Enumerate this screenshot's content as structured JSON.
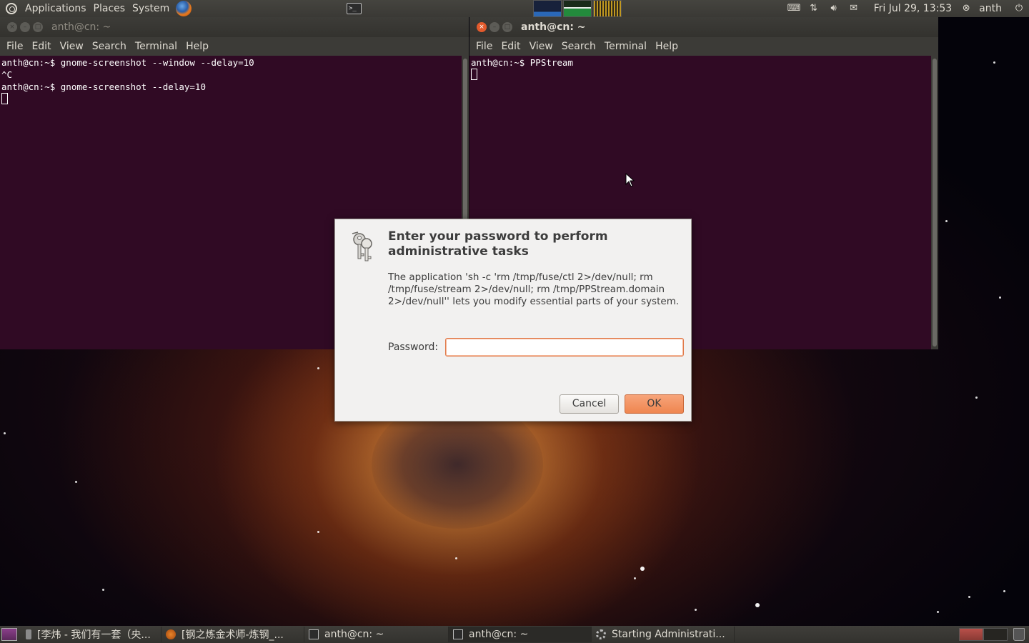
{
  "top_panel": {
    "menus": [
      "Applications",
      "Places",
      "System"
    ],
    "clock": "Fri Jul 29, 13:53",
    "user": "anth",
    "terminal_launcher_glyph": ">_",
    "tray_icons": [
      "keyboard-icon",
      "network-icon",
      "volume-icon",
      "mail-icon"
    ]
  },
  "left_terminal": {
    "title": "anth@cn: ~",
    "menu": [
      "File",
      "Edit",
      "View",
      "Search",
      "Terminal",
      "Help"
    ],
    "lines": [
      "anth@cn:~$ gnome-screenshot --window --delay=10",
      "^C",
      "anth@cn:~$ gnome-screenshot --delay=10"
    ]
  },
  "right_terminal": {
    "title": "anth@cn: ~",
    "menu": [
      "File",
      "Edit",
      "View",
      "Search",
      "Terminal",
      "Help"
    ],
    "lines": [
      "anth@cn:~$ PPStream"
    ]
  },
  "dialog": {
    "heading": "Enter your password to perform administrative tasks",
    "message": "The application 'sh -c 'rm /tmp/fuse/ctl  2>/dev/null; rm /tmp/fuse/stream  2>/dev/null; rm /tmp/PPStream.domain 2>/dev/null'' lets you modify essential parts of your system.",
    "password_label": "Password:",
    "password_value": "",
    "cancel_label": "Cancel",
    "ok_label": "OK"
  },
  "taskbar": {
    "tasks": [
      {
        "label": "[李炜 - 我们有一套（央..."
      },
      {
        "label": "[钢之炼金术师-炼钢_..."
      },
      {
        "label": "anth@cn: ~"
      },
      {
        "label": "anth@cn: ~"
      },
      {
        "label": "Starting Administrati..."
      }
    ]
  },
  "colors": {
    "terminal_bg": "#300a24",
    "panel_bg": "#3c3b37",
    "accent_orange": "#ef8650",
    "close_button": "#e35a2c"
  }
}
